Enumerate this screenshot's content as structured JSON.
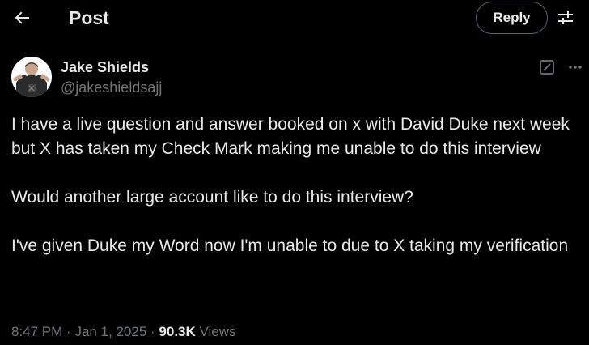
{
  "header": {
    "title": "Post",
    "reply_label": "Reply",
    "back_icon": "arrow-left-icon",
    "settings_icon": "sliders-icon"
  },
  "author": {
    "name": "Jake Shields",
    "handle": "@jakeshieldsajj",
    "grok_icon": "grok-icon",
    "more_icon": "more-icon"
  },
  "post": {
    "paragraphs": [
      "I have a live question and answer booked on x with David Duke next week but X has taken my Check Mark making me unable to do this interview",
      "Would another large account like to do this interview?",
      "I've given Duke my Word now I'm unable to due to X taking my verification"
    ]
  },
  "meta": {
    "time": "8:47 PM",
    "separator": "·",
    "date": "Jan 1, 2025",
    "views_count": "90.3K",
    "views_label": "Views"
  },
  "colors": {
    "background": "#000000",
    "text_primary": "#e7e9ea",
    "text_secondary": "#71767b",
    "border": "#536471"
  }
}
